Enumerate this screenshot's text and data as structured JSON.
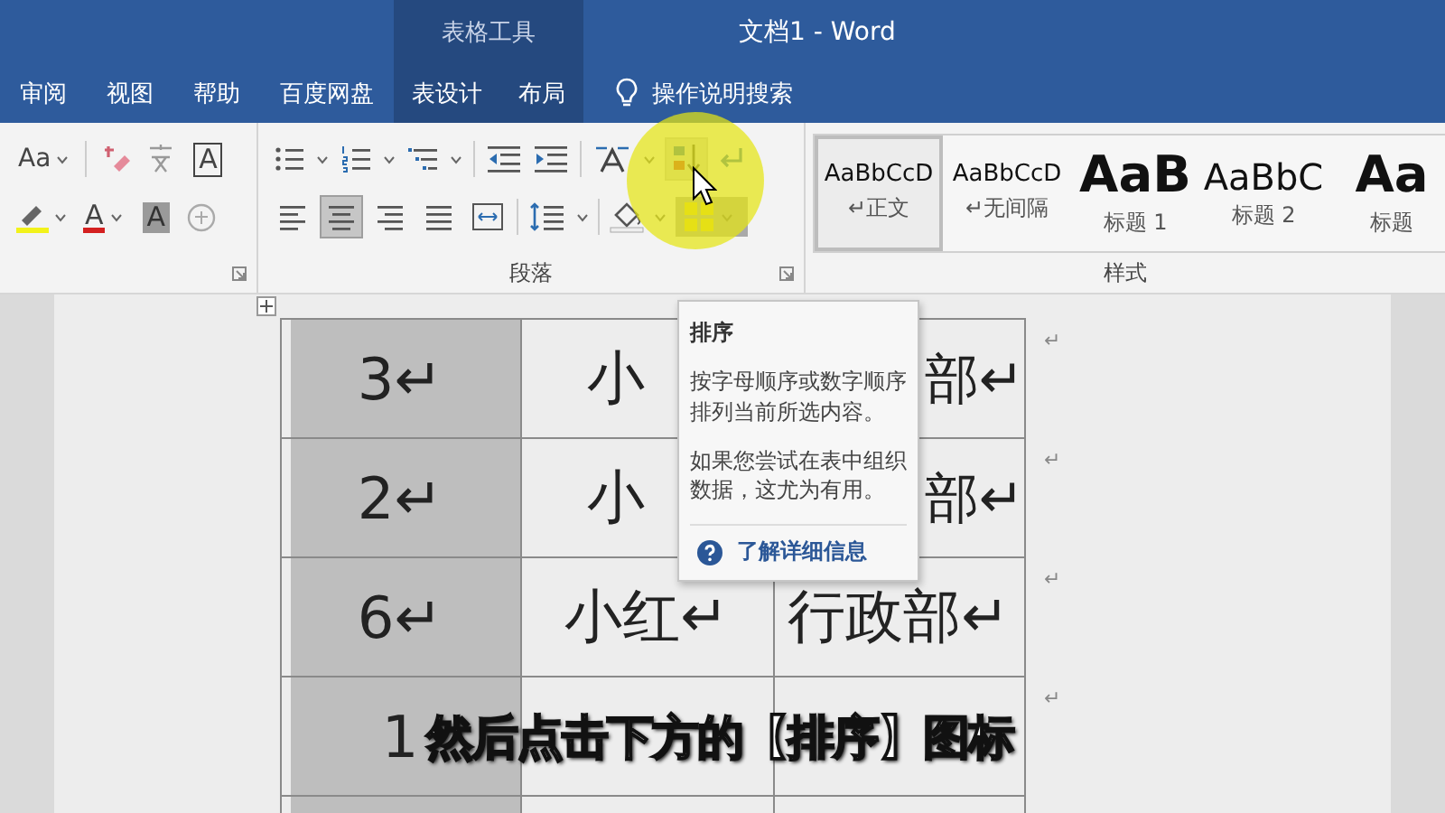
{
  "window": {
    "title": "文档1 - Word",
    "context_label": "表格工具"
  },
  "tabs": [
    {
      "label": "审阅",
      "contextual": false
    },
    {
      "label": "视图",
      "contextual": false
    },
    {
      "label": "帮助",
      "contextual": false
    },
    {
      "label": "百度网盘",
      "contextual": false
    },
    {
      "label": "表设计",
      "contextual": true
    },
    {
      "label": "布局",
      "contextual": true
    }
  ],
  "search": {
    "label": "操作说明搜索"
  },
  "ribbon": {
    "font_group": {
      "case_button": "Aa",
      "border_button": "A",
      "color_button": "A",
      "shading_button": "A"
    },
    "paragraph_group": {
      "label": "段落",
      "sort_button": {
        "hovered": true
      },
      "borders_button": {
        "pressed": true
      },
      "alignment": [
        {
          "selected": false
        },
        {
          "selected": true
        },
        {
          "selected": false
        },
        {
          "selected": false
        },
        {
          "selected": false
        }
      ]
    },
    "styles_group": {
      "label": "样式",
      "styles": [
        {
          "sample": "AaBbCcD",
          "name": "↵正文",
          "kind": "body",
          "selected": true
        },
        {
          "sample": "AaBbCcD",
          "name": "↵无间隔",
          "kind": "body",
          "selected": false
        },
        {
          "sample": "AaB",
          "name": "标题 1",
          "kind": "heading1",
          "selected": false
        },
        {
          "sample": "AaBbC",
          "name": "标题 2",
          "kind": "heading2",
          "selected": false
        },
        {
          "sample": "Aa",
          "name": "标题",
          "kind": "heading1",
          "selected": false
        }
      ]
    }
  },
  "table": {
    "rows": [
      {
        "cells": [
          {
            "text": "3↵"
          },
          {
            "text": "小",
            "clipped_right": true
          },
          {
            "text": "部↵",
            "clipped_left": true
          }
        ],
        "end_mark": "↵"
      },
      {
        "cells": [
          {
            "text": "2↵"
          },
          {
            "text": "小",
            "clipped_right": true
          },
          {
            "text": "部↵",
            "clipped_left": true
          }
        ],
        "end_mark": "↵"
      },
      {
        "cells": [
          {
            "text": "6↵"
          },
          {
            "text": "小红↵"
          },
          {
            "text": "行政部↵"
          }
        ],
        "end_mark": "↵"
      },
      {
        "cells": [
          {
            "text": "1"
          }
        ],
        "end_mark": "↵"
      }
    ]
  },
  "tooltip": {
    "title": "排序",
    "paragraphs": [
      "按字母顺序或数字顺序排列当前所选内容。",
      "如果您尝试在表中组织数据，这尤为有用。"
    ],
    "link": "了解详细信息"
  },
  "caption": "然后点击下方的【排序】图标"
}
